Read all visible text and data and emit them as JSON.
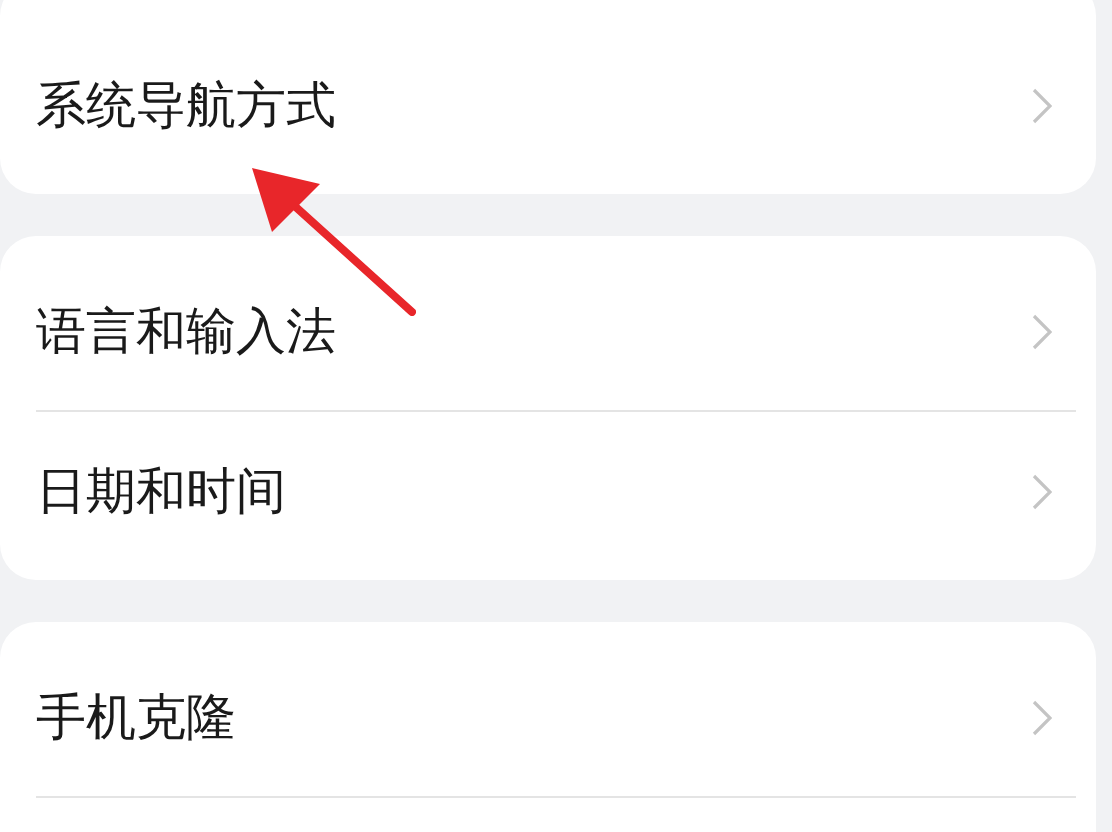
{
  "groups": [
    {
      "items": [
        {
          "label": "系统导航方式"
        }
      ],
      "cut_off": false
    },
    {
      "items": [
        {
          "label": "语言和输入法"
        },
        {
          "label": "日期和时间"
        }
      ],
      "cut_off": false
    },
    {
      "items": [
        {
          "label": "手机克隆"
        }
      ],
      "cut_off": true
    }
  ],
  "annotation": {
    "kind": "arrow"
  }
}
